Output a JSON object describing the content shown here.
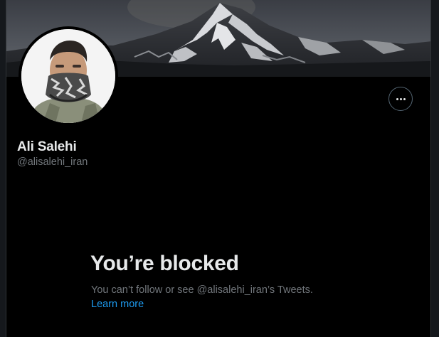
{
  "profile": {
    "display_name": "Ali Salehi",
    "handle": "@alisalehi_iran"
  },
  "blocked": {
    "title": "You’re blocked",
    "message": "You can’t follow or see @alisalehi_iran’s Tweets.",
    "learn_more": "Learn more"
  },
  "icons": {
    "more": "more-horizontal-icon"
  },
  "colors": {
    "background": "#000000",
    "primary_text": "#e7e9ea",
    "secondary_text": "#71767b",
    "link": "#1d9bf0",
    "border": "#2f3336"
  }
}
